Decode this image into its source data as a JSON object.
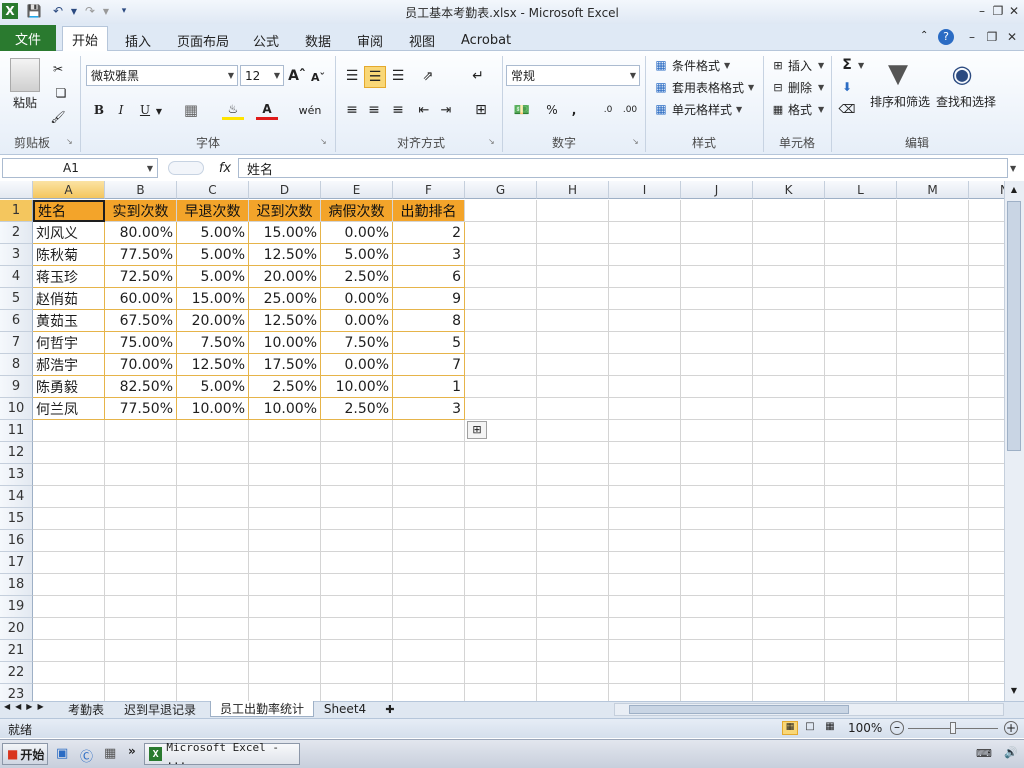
{
  "window": {
    "title": "员工基本考勤表.xlsx  -  Microsoft Excel"
  },
  "ribbon_tabs": {
    "file": "文件",
    "tabs": [
      "开始",
      "插入",
      "页面布局",
      "公式",
      "数据",
      "审阅",
      "视图",
      "Acrobat"
    ]
  },
  "ribbon": {
    "clipboard": {
      "paste": "粘贴",
      "label": "剪贴板"
    },
    "font": {
      "name": "微软雅黑",
      "size": "12",
      "label": "字体",
      "bold": "B",
      "italic": "I",
      "underline": "U"
    },
    "alignment": {
      "label": "对齐方式"
    },
    "number": {
      "format": "常规",
      "label": "数字",
      "percent": "%",
      "comma": ","
    },
    "styles": {
      "conditional": "条件格式",
      "table": "套用表格格式",
      "cell": "单元格样式",
      "label": "样式"
    },
    "cells": {
      "insert": "插入",
      "delete": "删除",
      "format": "格式",
      "label": "单元格"
    },
    "editing": {
      "sort": "排序和筛选",
      "find": "查找和选择",
      "label": "编辑",
      "sigma": "Σ"
    }
  },
  "formula_bar": {
    "name_box": "A1",
    "fx": "fx",
    "content": "姓名"
  },
  "sheet": {
    "columns": [
      "A",
      "B",
      "C",
      "D",
      "E",
      "F",
      "G",
      "H",
      "I",
      "J",
      "K",
      "L",
      "M",
      "N"
    ],
    "rows": [
      "1",
      "2",
      "3",
      "4",
      "5",
      "6",
      "7",
      "8",
      "9",
      "10",
      "11",
      "12",
      "13",
      "14",
      "15",
      "16",
      "17",
      "18",
      "19",
      "20",
      "21",
      "22",
      "23"
    ],
    "header": [
      "姓名",
      "实到次数",
      "早退次数",
      "迟到次数",
      "病假次数",
      "出勤排名"
    ],
    "data": [
      [
        "刘风义",
        "80.00%",
        "5.00%",
        "15.00%",
        "0.00%",
        "2"
      ],
      [
        "陈秋菊",
        "77.50%",
        "5.00%",
        "12.50%",
        "5.00%",
        "3"
      ],
      [
        "蒋玉珍",
        "72.50%",
        "5.00%",
        "20.00%",
        "2.50%",
        "6"
      ],
      [
        "赵俏茹",
        "60.00%",
        "15.00%",
        "25.00%",
        "0.00%",
        "9"
      ],
      [
        "黄茹玉",
        "67.50%",
        "20.00%",
        "12.50%",
        "0.00%",
        "8"
      ],
      [
        "何哲宇",
        "75.00%",
        "7.50%",
        "10.00%",
        "7.50%",
        "5"
      ],
      [
        "郝浩宇",
        "70.00%",
        "12.50%",
        "17.50%",
        "0.00%",
        "7"
      ],
      [
        "陈勇毅",
        "82.50%",
        "5.00%",
        "2.50%",
        "10.00%",
        "1"
      ],
      [
        "何兰凤",
        "77.50%",
        "10.00%",
        "10.00%",
        "2.50%",
        "3"
      ]
    ]
  },
  "sheet_tabs": [
    "考勤表",
    "迟到早退记录",
    "员工出勤率统计",
    "Sheet4"
  ],
  "status": {
    "ready": "就绪",
    "zoom": "100%"
  },
  "taskbar": {
    "start": "开始",
    "app": "Microsoft Excel - ..."
  },
  "colors": {
    "header_fill": "#f3a42a",
    "data_border": "#e6b44a",
    "file_tab": "#2a7a2f"
  }
}
